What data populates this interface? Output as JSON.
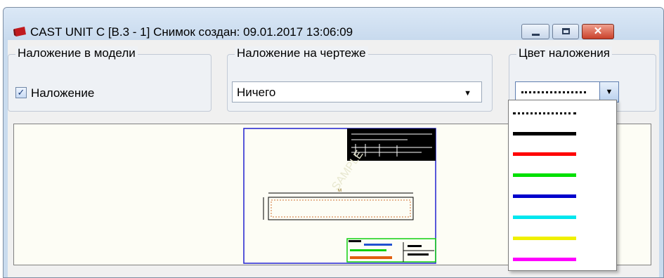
{
  "window": {
    "title": "CAST UNIT C   [B.3 - 1]  Снимок создан: 09.01.2017 13:06:09",
    "close_glyph": "✕"
  },
  "model_overlay": {
    "group_label": "Наложение в модели",
    "checkbox_label": "Наложение",
    "checked": true,
    "check_glyph": "✓"
  },
  "drawing_overlay": {
    "group_label": "Наложение на чертеже",
    "selected": "Ничего",
    "arrow": "▼"
  },
  "overlay_color": {
    "group_label": "Цвет наложения",
    "selected_color": "dotted-black",
    "arrow": "▼",
    "options": [
      "dotted-black",
      "#000000",
      "#ff0000",
      "#00e000",
      "#0000cc",
      "#00e6ee",
      "#f0f000",
      "#ff00ff"
    ]
  },
  "preview": {
    "watermark": "SAMPLE"
  }
}
